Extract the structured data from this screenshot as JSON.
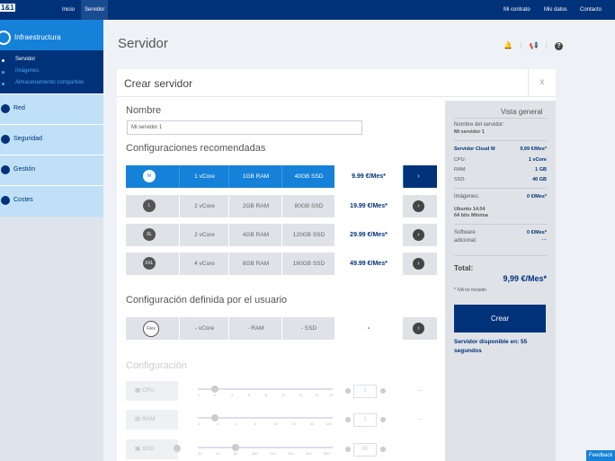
{
  "topbar": {
    "logo": "1&1",
    "nav_inicio": "Inicio",
    "nav_servidor": "Servidor",
    "mi_contrato": "Mi contrato",
    "mis_datos": "Mis datos",
    "contacto": "Contacto"
  },
  "sidebar": {
    "header": "Infraestructura",
    "sub": [
      "Servidor",
      "Imágenes",
      "Almacenamiento compartido"
    ],
    "items": [
      "Red",
      "Seguridad",
      "Gestión",
      "Costes"
    ]
  },
  "main": {
    "title": "Servidor"
  },
  "card": {
    "title": "Crear servidor",
    "close": "x",
    "nombre_label": "Nombre",
    "nombre_value": "Mi servidor 1",
    "recomendadas_label": "Configuraciones recomendadas",
    "usuario_label": "Configuración definida por el usuario",
    "configuracion_label": "Configuración"
  },
  "plans": [
    {
      "badge": "M",
      "vcore": "1 vCore",
      "ram": "1GB RAM",
      "ssd": "40GB SSD",
      "price": "9.99 €/Mes*",
      "selected": true
    },
    {
      "badge": "L",
      "vcore": "2 vCore",
      "ram": "2GB RAM",
      "ssd": "80GB SSD",
      "price": "19.99 €/Mes*"
    },
    {
      "badge": "XL",
      "vcore": "2 vCore",
      "ram": "4GB RAM",
      "ssd": "120GB SSD",
      "price": "29.99 €/Mes*"
    },
    {
      "badge": "XXL",
      "vcore": "4 vCore",
      "ram": "8GB RAM",
      "ssd": "160GB SSD",
      "price": "49.99 €/Mes*"
    }
  ],
  "flex": {
    "badge": "Flex",
    "vcore": "- vCore",
    "ram": "- RAM",
    "ssd": "- SSD",
    "price": "-"
  },
  "config": {
    "cpu": {
      "label": "CPU",
      "value": "1",
      "ticks": [
        "1",
        "2",
        "4",
        "6",
        "8",
        "10",
        "12",
        "14",
        "16"
      ]
    },
    "ram": {
      "label": "RAM",
      "value": "1",
      "ticks": [
        "1",
        "2",
        "4",
        "8",
        "16",
        "32",
        "64",
        "128"
      ]
    },
    "ssd": {
      "label": "SSD",
      "value": "80",
      "ticks": [
        "20",
        "40",
        "80",
        "160",
        "240",
        "320",
        "400",
        "500"
      ]
    },
    "dash": "—"
  },
  "summary": {
    "title": "Vista general",
    "name_label": "Nombre del servidor:",
    "name_value": "Mi servidor 1",
    "plan_label": "Servidor Cloud M",
    "plan_price": "9,99 €/Mes*",
    "cpu_label": "CPU:",
    "cpu_value": "1 vCore",
    "ram_label": "RAM:",
    "ram_value": "1 GB",
    "ssd_label": "SSD:",
    "ssd_value": "40 GB",
    "images_label": "Imágenes:",
    "images_price": "0 €/Mes*",
    "image_name_1": "Ubuntu 14.04",
    "image_name_2": "64 bits Mínima",
    "software_label_1": "Software",
    "software_label_2": "adicional:",
    "software_price": "0 €/Mes*",
    "software_dash": "---",
    "total_label": "Total:",
    "total_value": "9,99 €/Mes*",
    "iva": "* IVA no incluido",
    "create_button": "Crear",
    "availability": "Servidor disponible en: 55 segundos"
  },
  "feedback": "Feedback"
}
